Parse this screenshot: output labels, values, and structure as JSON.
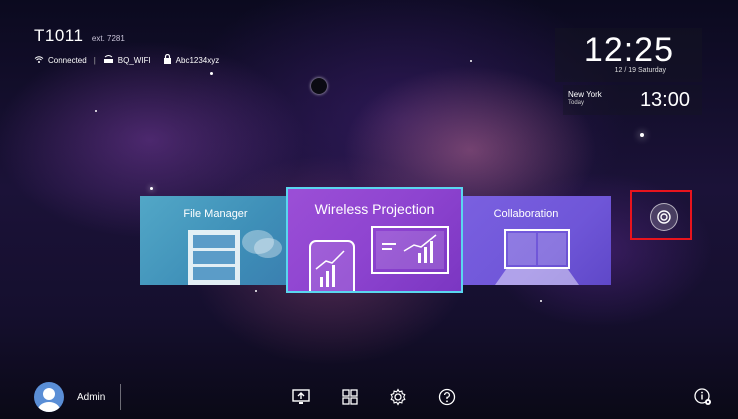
{
  "device": {
    "name": "T1011",
    "ext": "ext. 7281"
  },
  "network": {
    "status": "Connected",
    "ssid": "BQ_WIFI",
    "password": "Abc1234xyz"
  },
  "clock": {
    "time": "12:25",
    "date": "12 / 19 Saturday"
  },
  "world_clock": {
    "city": "New York",
    "day": "Today",
    "time": "13:00"
  },
  "tiles": {
    "file_manager": "File Manager",
    "wireless_projection": "Wireless Projection",
    "collaboration": "Collaboration"
  },
  "user": {
    "name": "Admin"
  },
  "colors": {
    "accent_border": "#5ad6f0",
    "highlight": "#e8141d"
  }
}
